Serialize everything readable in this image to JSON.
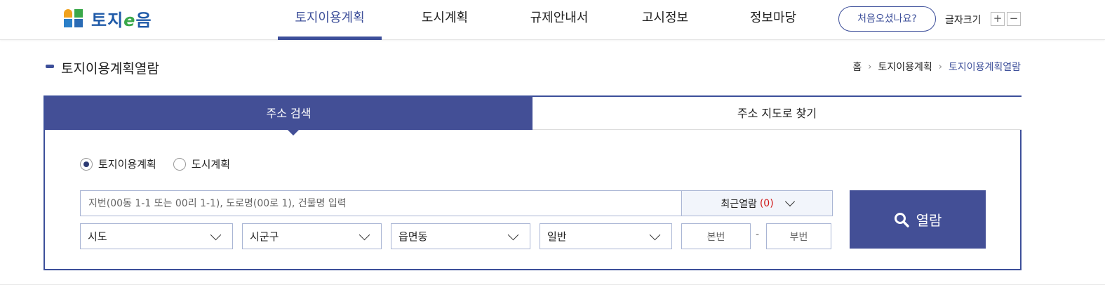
{
  "logo": {
    "text_main": "토지",
    "text_e": "e",
    "text_end": "음"
  },
  "nav": {
    "items": [
      {
        "label": "토지이용계획",
        "active": true
      },
      {
        "label": "도시계획",
        "active": false
      },
      {
        "label": "규제안내서",
        "active": false
      },
      {
        "label": "고시정보",
        "active": false
      },
      {
        "label": "정보마당",
        "active": false
      }
    ]
  },
  "header": {
    "first_visit_label": "처음오셨나요?",
    "font_size_label": "글자크기",
    "font_plus": "+",
    "font_minus": "−"
  },
  "page": {
    "title": "토지이용계획열람",
    "breadcrumb": [
      "홈",
      "토지이용계획",
      "토지이용계획열람"
    ]
  },
  "search": {
    "tabs": [
      {
        "label": "주소 검색",
        "active": true
      },
      {
        "label": "주소 지도로 찾기",
        "active": false
      }
    ],
    "radios": [
      {
        "label": "토지이용계획",
        "checked": true
      },
      {
        "label": "도시계획",
        "checked": false
      }
    ],
    "address_placeholder": "지번(00동 1-1 또는 00리 1-1), 도로명(00로 1), 건물명 입력",
    "recent_label": "최근열람",
    "recent_count": "(0)",
    "selects": [
      {
        "value": "시도"
      },
      {
        "value": "시군구"
      },
      {
        "value": "읍면동"
      },
      {
        "value": "일반"
      }
    ],
    "main_no_placeholder": "본번",
    "sub_no_placeholder": "부번",
    "dash": "-",
    "view_label": "열람"
  },
  "colors": {
    "accent": "#434f96",
    "brand_blue": "#1f5aa8",
    "brand_green": "#3aa84a",
    "count_red": "#d01818"
  }
}
